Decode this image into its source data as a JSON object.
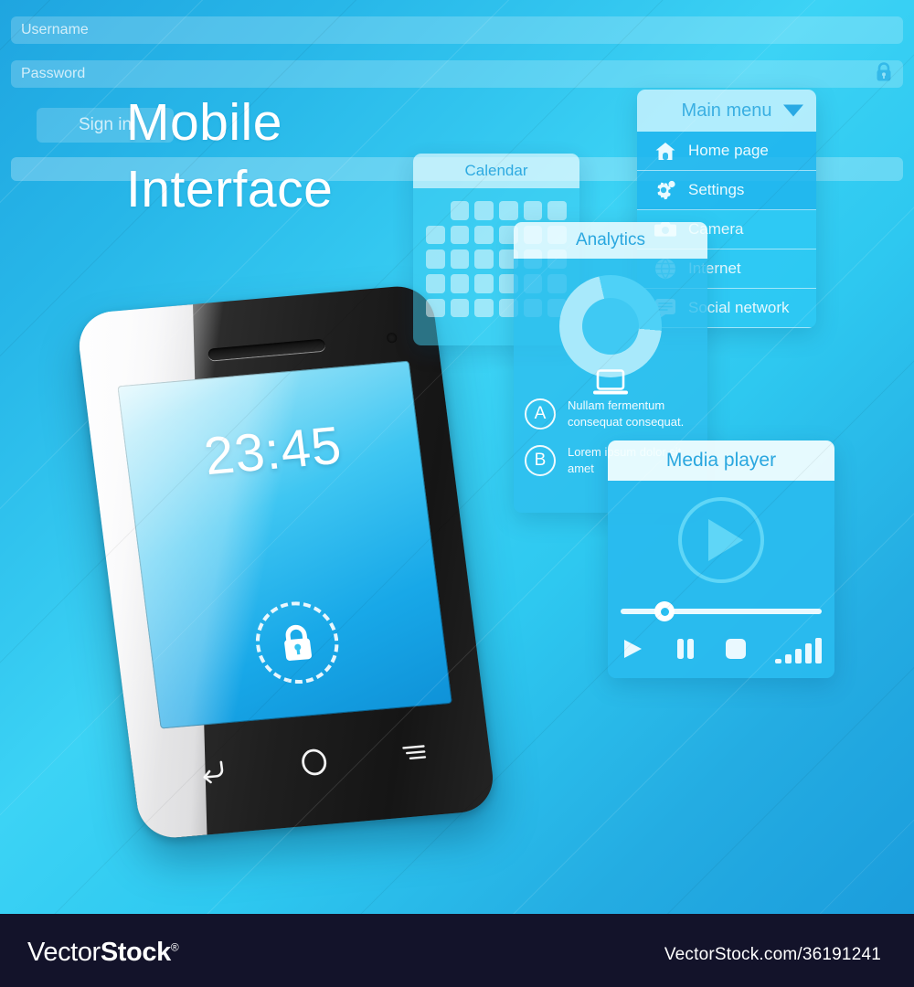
{
  "heading": {
    "line1": "Mobile",
    "line2": "Interface"
  },
  "phone": {
    "clock": "23:45",
    "lock_icon": "padlock-icon",
    "nav": [
      {
        "name": "back-button",
        "icon": "back-arrow-icon"
      },
      {
        "name": "home-button",
        "icon": "home-circle-icon"
      },
      {
        "name": "menu-button",
        "icon": "menu-lines-icon"
      }
    ]
  },
  "calendar": {
    "title": "Calendar",
    "cells": 30
  },
  "main_menu": {
    "title": "Main menu",
    "caret_icon": "chevron-down-icon",
    "items": [
      {
        "label": "Home page",
        "icon": "home-icon"
      },
      {
        "label": "Settings",
        "icon": "gear-icon"
      },
      {
        "label": "Camera",
        "icon": "camera-icon"
      },
      {
        "label": "Internet",
        "icon": "globe-icon"
      },
      {
        "label": "Social network",
        "icon": "chat-list-icon"
      }
    ]
  },
  "analytics": {
    "title": "Analytics",
    "center_icon": "laptop-icon",
    "legend": [
      {
        "badge": "A",
        "text": "Nullam fermentum consequat consequat."
      },
      {
        "badge": "B",
        "text": "Lorem ipsum dolor sit amet"
      }
    ]
  },
  "media_player": {
    "title": "Media player",
    "play_icon": "play-icon",
    "seek_percent": 22,
    "controls": [
      {
        "name": "play-button",
        "icon": "play-icon"
      },
      {
        "name": "pause-button",
        "icon": "pause-icon"
      },
      {
        "name": "stop-button",
        "icon": "stop-icon"
      },
      {
        "name": "volume-level",
        "icon": "signal-bars-icon"
      }
    ]
  },
  "login": {
    "username_placeholder": "Username",
    "password_placeholder": "Password",
    "password_icon": "lock-icon",
    "signin_label": "Sign in"
  },
  "footer": {
    "logo_prefix": "Vector",
    "logo_suffix": "Stock",
    "logo_mark": "®",
    "url": "VectorStock.com/36191241"
  },
  "chart_data": {
    "type": "pie",
    "title": "Analytics",
    "categories": [
      "A",
      "B"
    ],
    "values": [
      70,
      30
    ],
    "labels": [
      "Nullam fermentum consequat consequat.",
      "Lorem ipsum dolor sit amet"
    ],
    "colors": [
      "#a8e9fb",
      "#4ed1f7"
    ],
    "legend": "bottom",
    "grid": false
  }
}
